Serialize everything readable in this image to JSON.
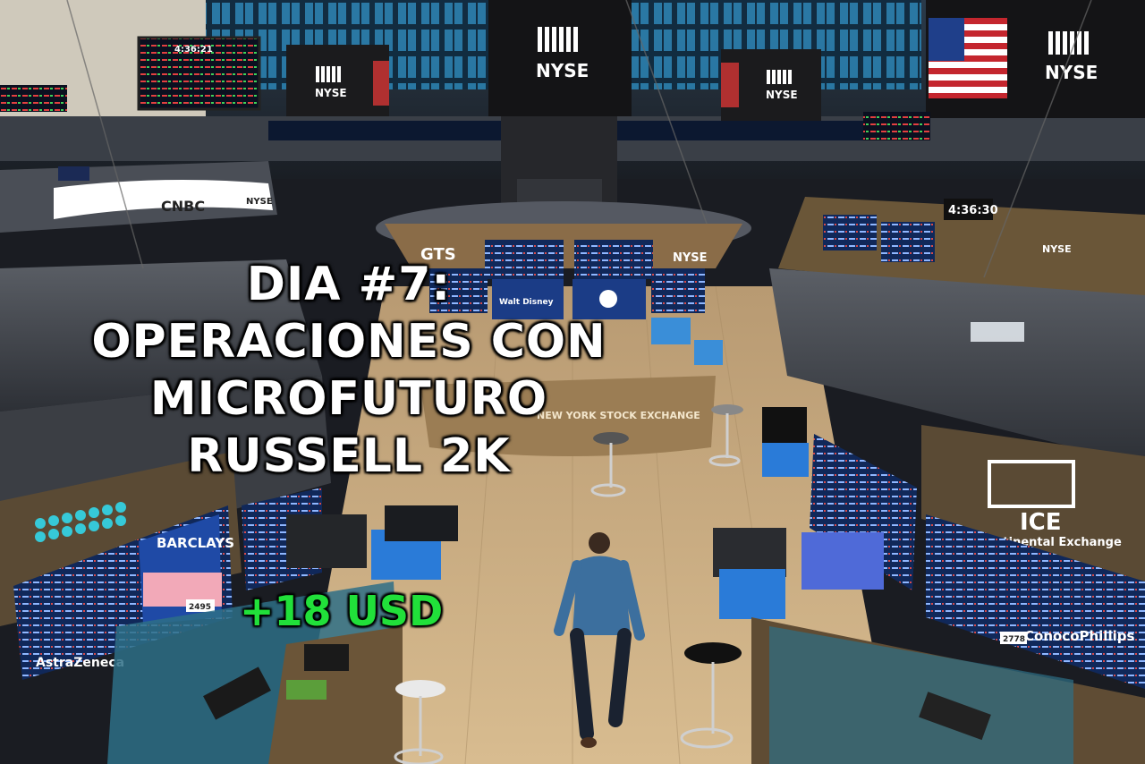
{
  "overlay": {
    "title_lines": [
      "DIA #7:",
      "OPERACIONES CON",
      "MICROFUTURO",
      "RUSSELL 2K"
    ],
    "gain": "+18 USD"
  },
  "scene_signage": {
    "nyse_sign_1": "NYSE",
    "nyse_sign_2": "NYSE",
    "nyse_sign_3": "NYSE",
    "nyse_sign_4": "NYSE",
    "booth_nyse": "NYSE",
    "right_booth_nyse": "NYSE",
    "cnbc": "CNBC",
    "cnbc_nyse": "NYSE",
    "clock_left": "4:36:21",
    "clock_right": "4:36:30",
    "exchange_band": "NEW YORK STOCK EXCHANGE",
    "ice_logo": "ICE",
    "ice_name": "Intercontinental Exchange",
    "conocophillips": "ConocoPhillips",
    "barclays": "BARCLAYS",
    "astrazeneca": "AstraZeneca",
    "gts": "GTS",
    "disney": "Walt Disney",
    "post_number_left": "2495",
    "post_number_right": "2778"
  },
  "colors": {
    "gain_green": "#21e03a",
    "title_white": "#ffffff",
    "screen_blue": "#1e4fa8",
    "floor_wood": "#c9a878"
  }
}
